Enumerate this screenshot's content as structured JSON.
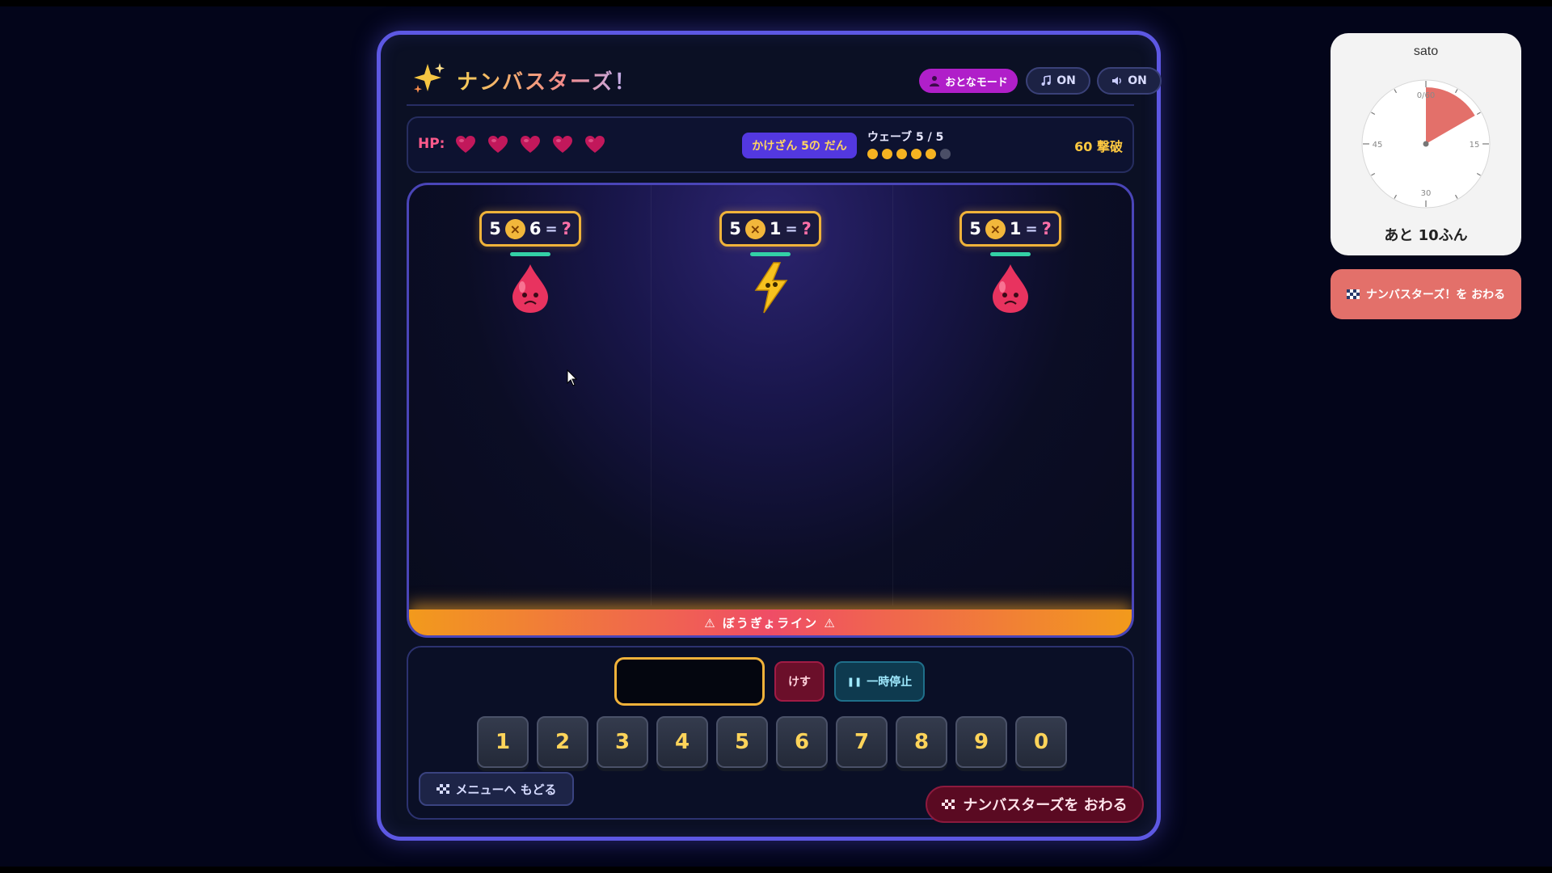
{
  "app": {
    "title": "ナンバスターズ！",
    "adult_mode_label": "おとなモード",
    "music_label": "ON",
    "sound_label": "ON"
  },
  "status": {
    "hp_label": "HP:",
    "hp_value": 5,
    "hp_max": 5,
    "level_label": "かけざん 5の だん",
    "wave_label": "ウェーブ 5 / 5",
    "waves_total": 6,
    "waves_filled": 5,
    "score_label": "60 撃破"
  },
  "enemies": [
    {
      "left": "5",
      "op": "×",
      "right": "6",
      "eq": "=",
      "answer": "?",
      "type": "drop-creature",
      "health": 1.0
    },
    {
      "left": "5",
      "op": "×",
      "right": "1",
      "eq": "=",
      "answer": "?",
      "type": "lightning-creature",
      "health": 1.0
    },
    {
      "left": "5",
      "op": "×",
      "right": "1",
      "eq": "=",
      "answer": "?",
      "type": "drop-creature",
      "health": 1.0
    }
  ],
  "defense_line_label": "⚠ ぼうぎょライン ⚠",
  "controls": {
    "answer_value": "",
    "clear_label": "けす",
    "pause_label": "一時停止",
    "keys": [
      "1",
      "2",
      "3",
      "4",
      "5",
      "6",
      "7",
      "8",
      "9",
      "0"
    ],
    "menu_label": "メニューへ もどる",
    "quit_label": "ナンバスターズを おわる"
  },
  "timer": {
    "user": "sato",
    "remaining_label": "あと 10ふん",
    "elapsed_fraction": 0.1667,
    "labels": {
      "top": "0/60",
      "right": "15",
      "bottom": "30",
      "left": "45"
    },
    "end_label": "ナンバスターズ！を おわる"
  },
  "colors": {
    "frame_border": "#5d58e3",
    "accent_gold": "#f1b23a",
    "hp_heart": "#c2185b",
    "timer_wedge": "#e3706a"
  }
}
